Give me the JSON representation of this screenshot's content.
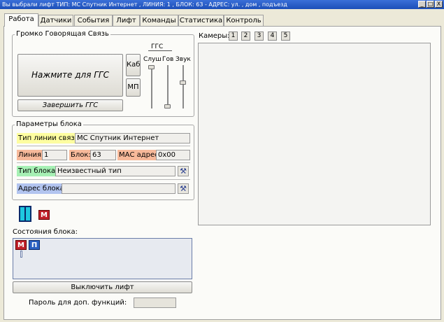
{
  "window": {
    "title": "Вы выбрали лифт  ТИП: МС Спутник Интернет , ЛИНИЯ: 1 , БЛОК: 63 - АДРЕС: ул. , дом , подъезд",
    "minimize_glyph": "_",
    "maximize_glyph": "□",
    "close_glyph": "X"
  },
  "tabs": [
    {
      "label": "Работа"
    },
    {
      "label": "Датчики"
    },
    {
      "label": "События"
    },
    {
      "label": "Лифт"
    },
    {
      "label": "Команды"
    },
    {
      "label": "Статистика"
    },
    {
      "label": "Контроль"
    }
  ],
  "ggs": {
    "group_title": "Громко Говорящая Связь",
    "main_button": "Нажмите для ГГС",
    "kab_button": "Каб",
    "mp_button": "МП",
    "finish_button": "Завершить ГГС",
    "mixer_title": "ГГС",
    "sliders": [
      {
        "label": "Слуш",
        "level": 1.0
      },
      {
        "label": "Гов",
        "level": 0.0
      },
      {
        "label": "Звук",
        "level": 0.6
      }
    ]
  },
  "block_params": {
    "group_title": "Параметры блока",
    "line_type_label": "Тип линии связи:",
    "line_type_value": "МС Спутник Интернет",
    "line_label": "Линия:",
    "line_value": "1",
    "block_label": "Блок:",
    "block_value": "63",
    "mac_label": "МАС адрес:",
    "mac_value": "0x00",
    "block_type_label": "Тип блока:",
    "block_type_value": "Неизвестный тип",
    "address_label": "Адрес блока:",
    "address_value": ""
  },
  "indicators": {
    "m_badge": "М",
    "p_badge": "П"
  },
  "state": {
    "label": "Состояния блока:"
  },
  "actions": {
    "disable_lift": "Выключить лифт",
    "password_label": "Пароль для доп. функций:",
    "password_value": ""
  },
  "cameras": {
    "label": "Камеры:",
    "buttons": [
      "1",
      "2",
      "3",
      "4",
      "5"
    ]
  },
  "colors": {
    "line_type_bg": "#fdfda0",
    "line_bg": "#f7b99a",
    "mac_bg": "#f7b99a",
    "block_type_bg": "#a6f0b4",
    "address_bg": "#b2c4ef",
    "m_badge_bg": "#c0202a",
    "p_badge_bg": "#2a5fc0",
    "lift_icon": "#1ec8e0"
  }
}
